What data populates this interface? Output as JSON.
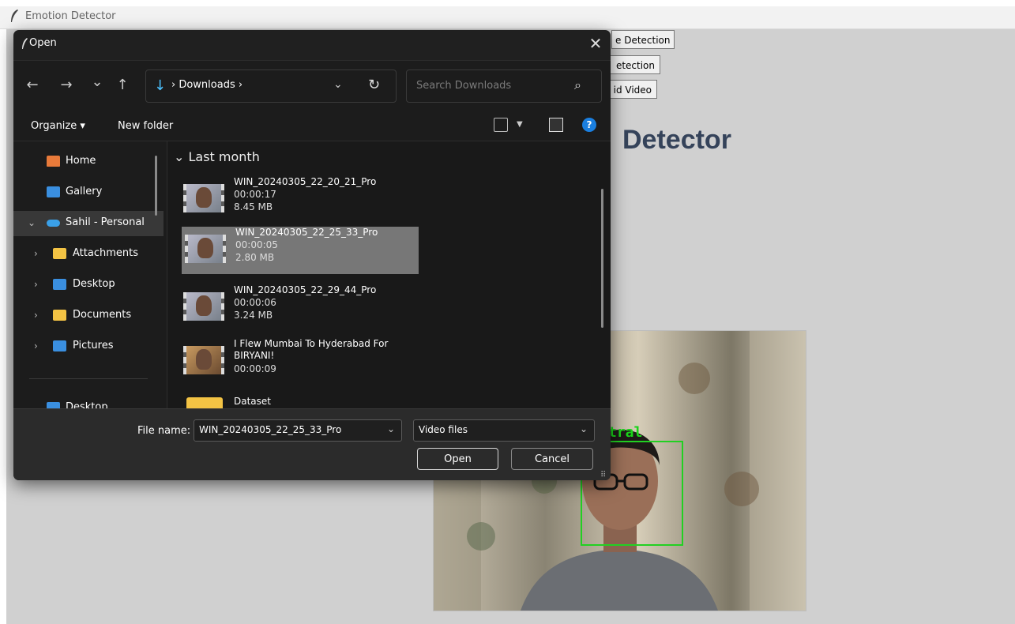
{
  "app": {
    "title": "Emotion Detector",
    "buttons": [
      "e Detection",
      "etection",
      "id Video"
    ],
    "heading": "Detector",
    "emotion_label": "tral"
  },
  "dialog": {
    "title": "Open",
    "close_label": "✕",
    "nav": {
      "back": "←",
      "forward": "→",
      "recent": "⌄",
      "up": "↑",
      "address_icon": "↓",
      "address_path": "›  Downloads  ›",
      "address_dropdown": "⌄",
      "refresh": "↻",
      "search_placeholder": "Search Downloads",
      "search_icon": "⌕"
    },
    "commands": {
      "organize": "Organize ▾",
      "new_folder": "New folder",
      "help": "?"
    },
    "nav_pane": [
      {
        "label": "Home",
        "icon": "home-icon",
        "chevron": ""
      },
      {
        "label": "Gallery",
        "icon": "gallery-icon",
        "chevron": ""
      },
      {
        "label": "Sahil - Personal",
        "icon": "onedrive-icon",
        "chevron": "⌄"
      },
      {
        "label": "Attachments",
        "icon": "folder-icon",
        "chevron": "›"
      },
      {
        "label": "Desktop",
        "icon": "desktop-icon",
        "chevron": "›"
      },
      {
        "label": "Documents",
        "icon": "folder-icon",
        "chevron": "›"
      },
      {
        "label": "Pictures",
        "icon": "pictures-icon",
        "chevron": "›"
      },
      {
        "label": "Desktop",
        "icon": "desktop-icon",
        "chevron": ""
      }
    ],
    "group_header": "Last month",
    "group_chevron": "⌄",
    "files": [
      {
        "name": "WIN_20240305_22_20_21_Pro",
        "duration": "00:00:17",
        "size": "8.45 MB"
      },
      {
        "name": "WIN_20240305_22_25_33_Pro",
        "duration": "00:00:05",
        "size": "2.80 MB"
      },
      {
        "name": "WIN_20240305_22_29_44_Pro",
        "duration": "00:00:06",
        "size": "3.24 MB"
      },
      {
        "name": "I Flew Mumbai To Hyderabad For BIRYANI!",
        "duration": "00:00:09",
        "size": ""
      }
    ],
    "folder_item": "Dataset",
    "file_name_label": "File name:",
    "file_name_value": "WIN_20240305_22_25_33_Pro",
    "file_type_value": "Video files",
    "open_label": "Open",
    "cancel_label": "Cancel"
  },
  "colors": {
    "accent": "#4cc2ff",
    "selection": "#777777",
    "face_box": "#22d022",
    "heading": "#35435a"
  }
}
